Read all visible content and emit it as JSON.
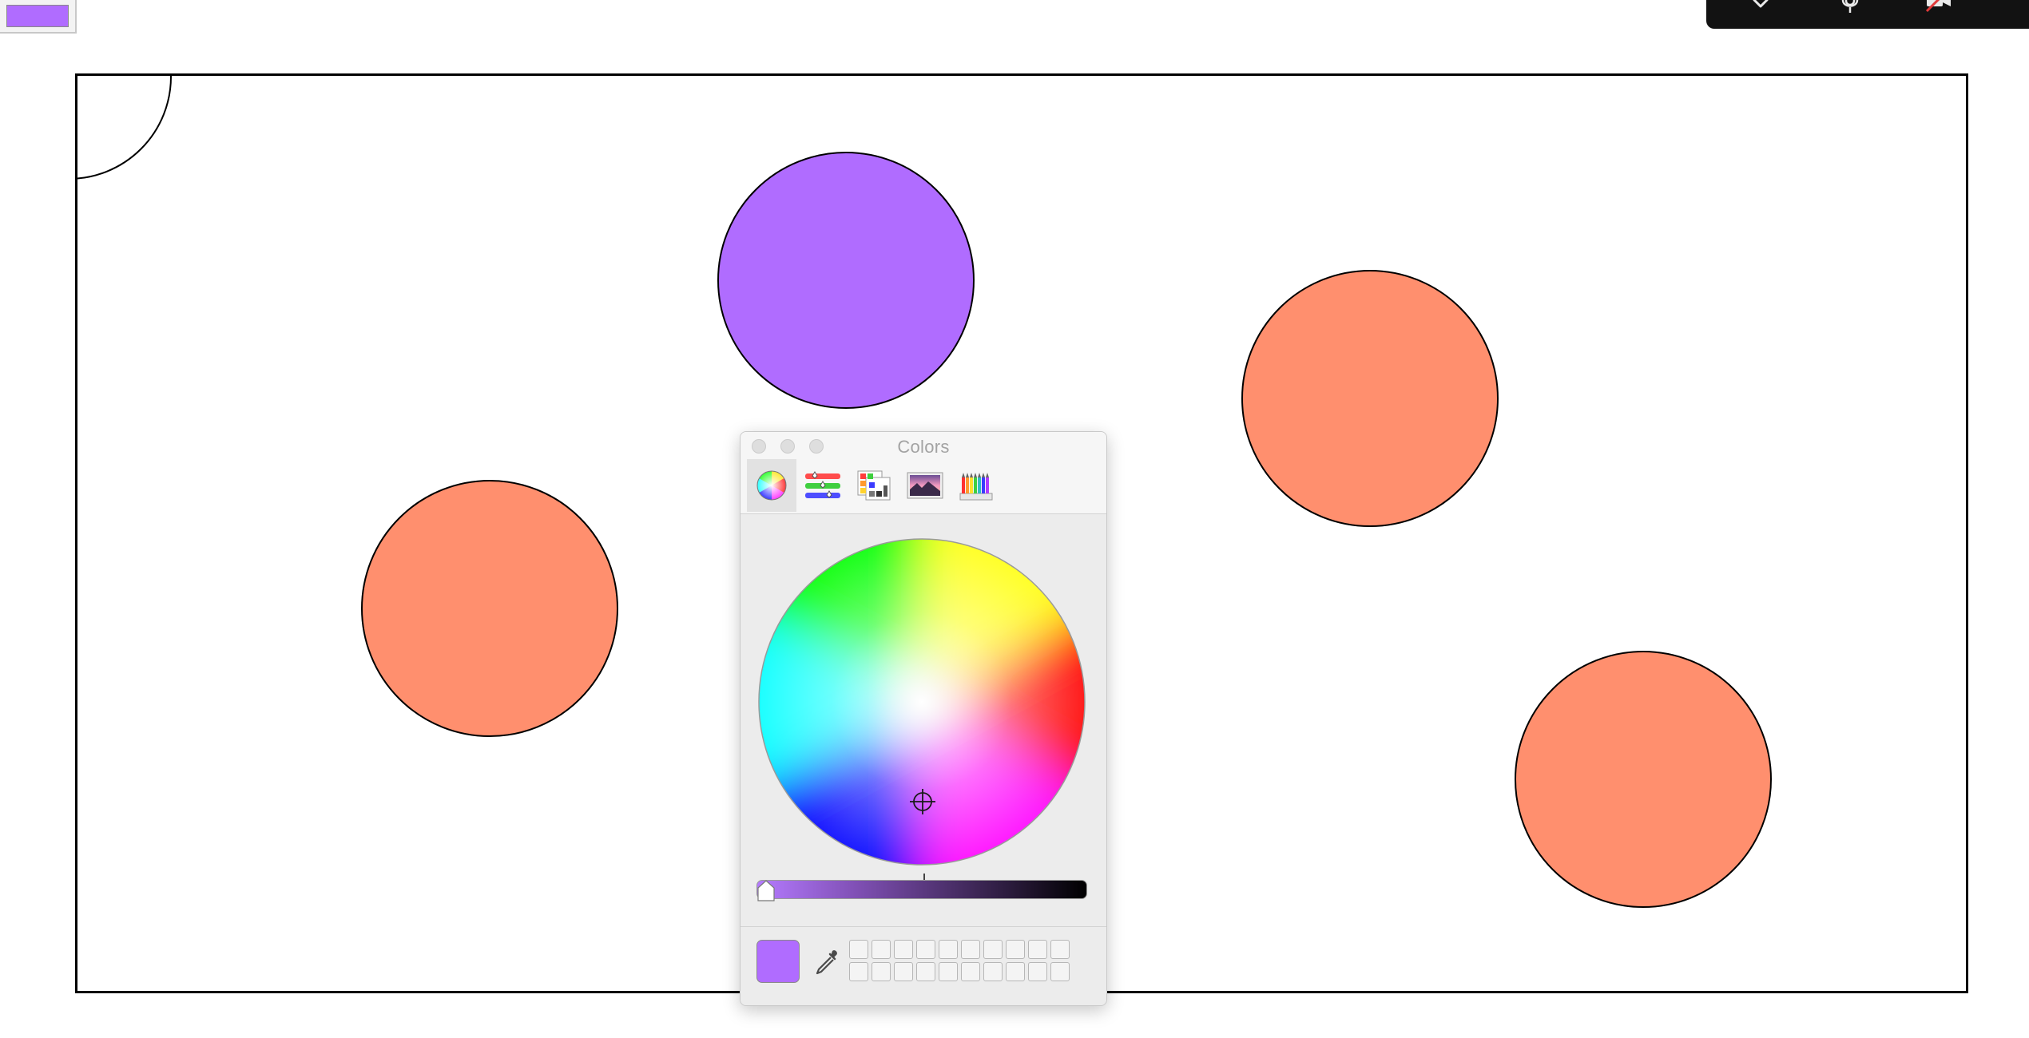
{
  "color_well": {
    "color": "#b06cff"
  },
  "toolbar": {
    "icons": [
      "chevron-down-icon",
      "microphone-icon",
      "camera-off-icon"
    ]
  },
  "canvas": {
    "shape_fill_purple": "#b06cff",
    "shape_fill_salmon": "#ff8f6e",
    "stroke": "#000000"
  },
  "colors_panel": {
    "title": "Colors",
    "tabs": [
      "color-wheel",
      "color-sliders",
      "color-palettes",
      "image-palettes",
      "pencils"
    ],
    "active_tab": "color-wheel",
    "current_color": "#b06cff",
    "brightness_level": 1.0,
    "swatch_slots": 20
  }
}
